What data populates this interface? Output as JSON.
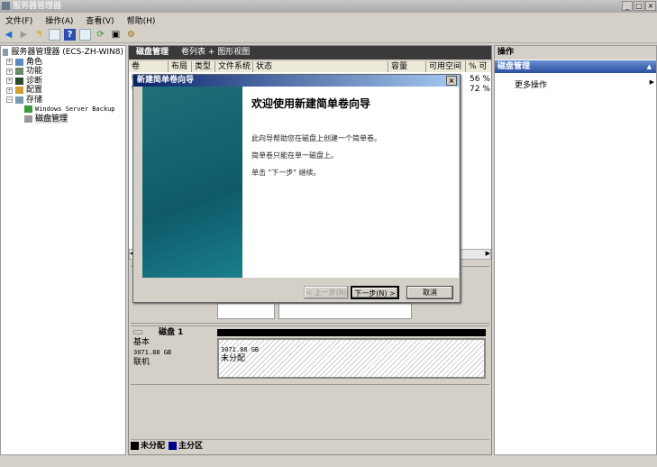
{
  "window": {
    "title": "服务器管理器",
    "controls": [
      "_",
      "□",
      "×"
    ]
  },
  "menu": [
    "文件(F)",
    "操作(A)",
    "查看(V)",
    "帮助(H)"
  ],
  "toolbar": [
    "back-icon",
    "forward-icon",
    "up-icon",
    "show-hide-icon",
    "help-icon",
    "view-icon",
    "refresh-icon",
    "properties-icon",
    "settings-icon"
  ],
  "tree": {
    "root": "服务器管理器 (ECS-ZH-WIN8)",
    "items": [
      "角色",
      "功能",
      "诊断",
      "配置",
      "存储"
    ],
    "storage_children": [
      "Windows Server Backup",
      "磁盘管理"
    ]
  },
  "center": {
    "title": "磁盘管理",
    "view": "卷列表 + 图形视图",
    "columns": [
      "卷",
      "布局",
      "类型",
      "文件系统",
      "状态",
      "容量",
      "可用空间",
      "% 可"
    ],
    "rows": [
      {
        "pct": "56 %"
      },
      {
        "pct": "72 %"
      }
    ],
    "disk1": {
      "name": "磁盘 1",
      "type": "基本",
      "size": "3071.88 GB",
      "status": "联机",
      "volume_size": "3071.88 GB",
      "volume_state": "未分配"
    },
    "legend": [
      {
        "label": "未分配",
        "color": "#000000"
      },
      {
        "label": "主分区",
        "color": "#00008b"
      }
    ]
  },
  "actions": {
    "header": "操作",
    "section": "磁盘管理",
    "more": "更多操作"
  },
  "wizard": {
    "title": "新建简单卷向导",
    "heading": "欢迎使用新建简单卷向导",
    "lines": [
      "此向导帮助您在磁盘上创建一个简单卷。",
      "简单卷只能在单一磁盘上。",
      "单击 \"下一步\" 继续。"
    ],
    "back": "< 上一步(B)",
    "next": "下一步(N) >",
    "cancel": "取消",
    "close": "×"
  }
}
